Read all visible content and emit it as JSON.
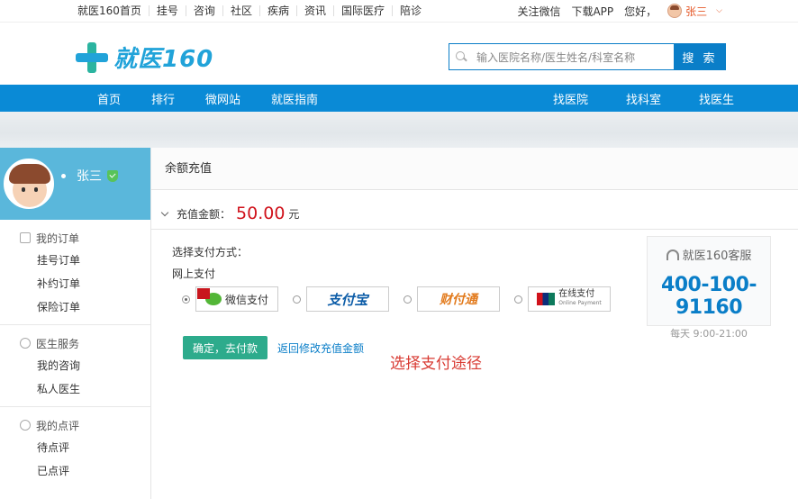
{
  "topbar": {
    "links": [
      "就医160首页",
      "挂号",
      "咨询",
      "社区",
      "疾病",
      "资讯",
      "国际医疗",
      "陪诊"
    ],
    "follow": "关注微信",
    "app": "下载APP",
    "hello": "您好，",
    "user": "张三",
    "user_color": "#e65a2a"
  },
  "header": {
    "logo_text": "就医160",
    "search_placeholder": "输入医院名称/医生姓名/科室名称",
    "search_button": "搜 索",
    "brand_color": "#0a7ec8"
  },
  "mainnav": {
    "left": [
      "首页",
      "排行",
      "微网站",
      "就医指南"
    ],
    "right": [
      "找医院",
      "找科室",
      "找医生"
    ]
  },
  "sidebar": {
    "profile_name": "张三",
    "groups": [
      {
        "title": "我的订单",
        "icon": "list-icon",
        "items": [
          "挂号订单",
          "补约订单",
          "保险订单"
        ]
      },
      {
        "title": "医生服务",
        "icon": "chat-icon",
        "items": [
          "我的咨询",
          "私人医生"
        ]
      },
      {
        "title": "我的点评",
        "icon": "comment-icon",
        "items": [
          "待点评",
          "已点评"
        ]
      }
    ]
  },
  "content": {
    "title": "余额充值",
    "amount_label": "充值金额：",
    "amount_value": "50.00",
    "amount_unit": "元",
    "pay_method_label": "选择支付方式：",
    "online_pay_label": "网上支付",
    "pay_options": [
      {
        "name": "微信支付",
        "selected": true
      },
      {
        "name": "支付宝",
        "selected": false
      },
      {
        "name": "财付通",
        "selected": false
      },
      {
        "name": "在线支付",
        "selected": false
      }
    ],
    "unionpay_sub": "Online Payment",
    "confirm_button": "确定，去付款",
    "back_link": "返回修改充值金额",
    "note": "选择支付途径"
  },
  "service": {
    "title": "就医160客服",
    "phone": "400-100-91160",
    "hours": "每天 9:00-21:00"
  }
}
